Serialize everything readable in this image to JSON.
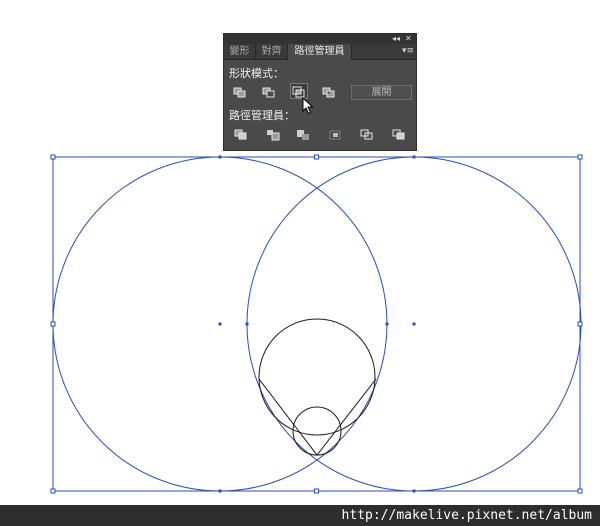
{
  "panel": {
    "collapse_glyph": "◂◂",
    "close_glyph": "✕",
    "menu_glyph": "▾≡",
    "tabs": [
      {
        "label": "變形",
        "active": false
      },
      {
        "label": "對齊",
        "active": false
      },
      {
        "label": "路徑管理員",
        "active": true
      }
    ],
    "shape_modes_label": "形狀模式：",
    "shape_mode_buttons": [
      "unite-icon",
      "minus-front-icon",
      "intersect-icon",
      "exclude-icon"
    ],
    "active_shape_mode": "intersect-icon",
    "expand_label": "展開",
    "pathfinders_label": "路徑管理員：",
    "pathfinder_buttons": [
      "divide-icon",
      "trim-icon",
      "merge-icon",
      "crop-icon",
      "outline-icon",
      "minus-back-icon"
    ]
  },
  "colors": {
    "selection": "#2a4fb5",
    "stroke": "#000000",
    "panel_bg": "#4a4a4a"
  },
  "watermark": "http://makelive.pixnet.net/album"
}
